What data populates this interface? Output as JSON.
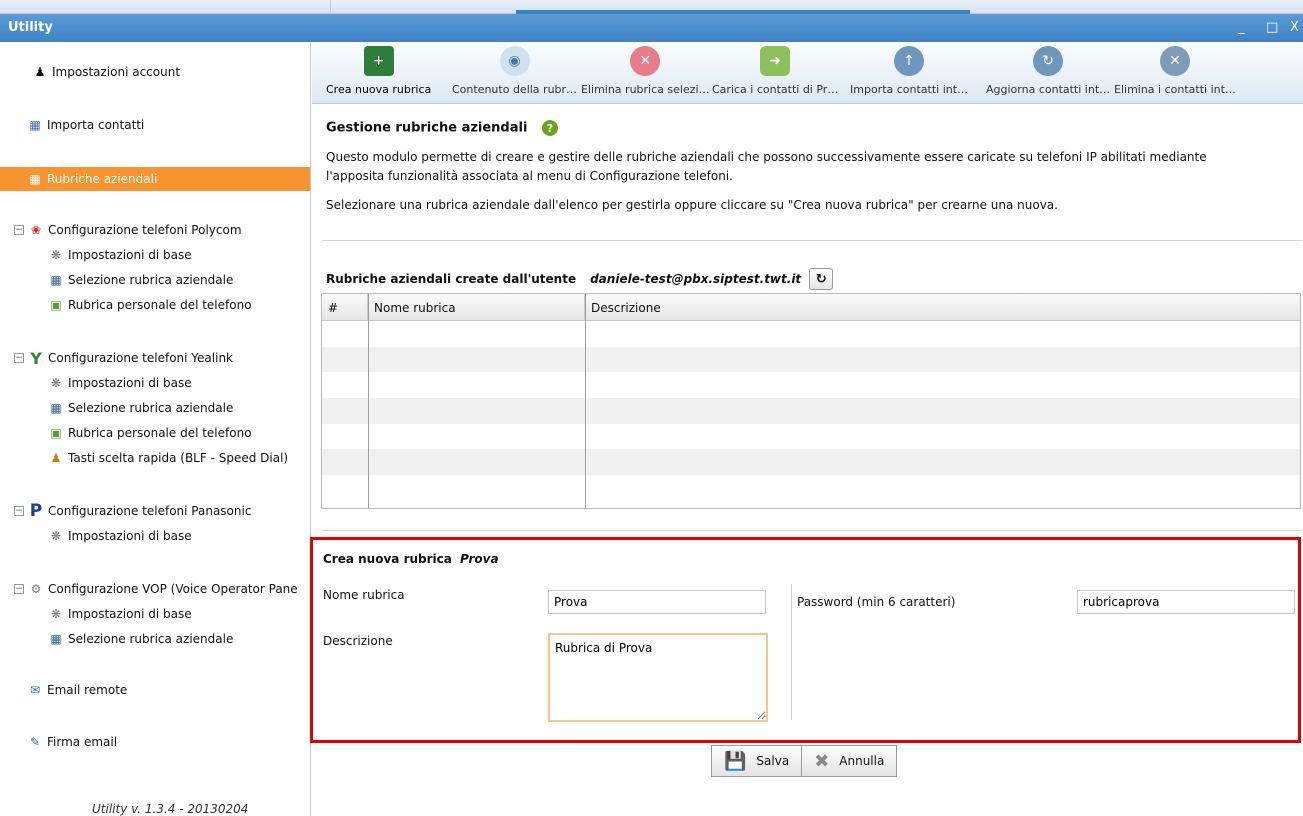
{
  "window": {
    "title": "Utility",
    "minimize": "_",
    "maximize": "□",
    "close": "X"
  },
  "sidebar": {
    "items": [
      {
        "label": "Impostazioni account",
        "icon": "user-icon"
      },
      {
        "label": "Importa contatti",
        "icon": "import-contacts-icon"
      },
      {
        "label": "Rubriche aziendali",
        "icon": "phonebook-icon",
        "active": true
      },
      {
        "label": "Configurazione telefoni Polycom",
        "icon": "polycom-icon",
        "toggle": "−"
      },
      {
        "label": "Impostazioni di base",
        "icon": "gear-icon"
      },
      {
        "label": "Selezione rubrica aziendale",
        "icon": "phonebook-icon"
      },
      {
        "label": "Rubrica personale del telefono",
        "icon": "contact-book-icon"
      },
      {
        "label": "Configurazione telefoni Yealink",
        "icon": "yealink-icon",
        "toggle": "−"
      },
      {
        "label": "Impostazioni di base",
        "icon": "gear-icon"
      },
      {
        "label": "Selezione rubrica aziendale",
        "icon": "phonebook-icon"
      },
      {
        "label": "Rubrica personale del telefono",
        "icon": "contact-book-icon"
      },
      {
        "label": "Tasti scelta rapida (BLF - Speed Dial)",
        "icon": "users-icon"
      },
      {
        "label": "Configurazione telefoni Panasonic",
        "icon": "panasonic-icon",
        "toggle": "−"
      },
      {
        "label": "Impostazioni di base",
        "icon": "gear-icon"
      },
      {
        "label": "Configurazione VOP (Voice Operator Pane",
        "icon": "vop-icon",
        "toggle": "−"
      },
      {
        "label": "Impostazioni di base",
        "icon": "gear-icon"
      },
      {
        "label": "Selezione rubrica aziendale",
        "icon": "phonebook-icon"
      },
      {
        "label": "Email remote",
        "icon": "email-icon"
      },
      {
        "label": "Firma email",
        "icon": "pen-icon"
      }
    ],
    "version": "Utility v. 1.3.4 - 20130204"
  },
  "toolbar": {
    "buttons": [
      {
        "label": "Crea nuova rubrica",
        "icon": "add-phonebook-icon",
        "color": "#2f7d3a"
      },
      {
        "label": "Contenuto della rubr…",
        "icon": "eye-icon",
        "color": "#9ab7cf"
      },
      {
        "label": "Elimina rubrica selezi…",
        "icon": "delete-icon",
        "color": "#e87c8b"
      },
      {
        "label": "Carica i contatti di Pr…",
        "icon": "upload-contacts-icon",
        "color": "#8fbf5a"
      },
      {
        "label": "Importa contatti int…",
        "icon": "import-users-icon",
        "color": "#6f97bd"
      },
      {
        "label": "Aggiorna contatti int…",
        "icon": "refresh-users-icon",
        "color": "#6f97bd"
      },
      {
        "label": "Elimina i contatti int…",
        "icon": "delete-users-icon",
        "color": "#7f9bb7"
      }
    ]
  },
  "main": {
    "title": "Gestione rubriche aziendali",
    "help_icon": "?",
    "desc1": "Questo modulo permette di creare e gestire delle rubriche aziendali che possono successivamente essere caricate su telefoni IP abilitati mediante",
    "desc2": "l'apposita funzionalità associata al menu di Configurazione telefoni.",
    "desc3": "Selezionare una rubrica aziendale dall'elenco per gestirla oppure cliccare su \"Crea nuova rubrica\" per crearne una nuova.",
    "list_title": "Rubriche aziendali create dall'utente",
    "user": "daniele-test@pbx.siptest.twt.it",
    "refresh_icon": "↻",
    "table": {
      "columns": [
        "#",
        "Nome rubrica",
        "Descrizione"
      ],
      "rows": []
    }
  },
  "form": {
    "title": "Crea nuova rubrica",
    "name_emph": "Prova",
    "name_label": "Nome rubrica",
    "name_value": "Prova",
    "password_label": "Password (min 6 caratteri)",
    "password_value": "rubricaprova",
    "desc_label": "Descrizione",
    "desc_value": "Rubrica di Prova",
    "save_label": "Salva",
    "cancel_label": "Annulla"
  }
}
